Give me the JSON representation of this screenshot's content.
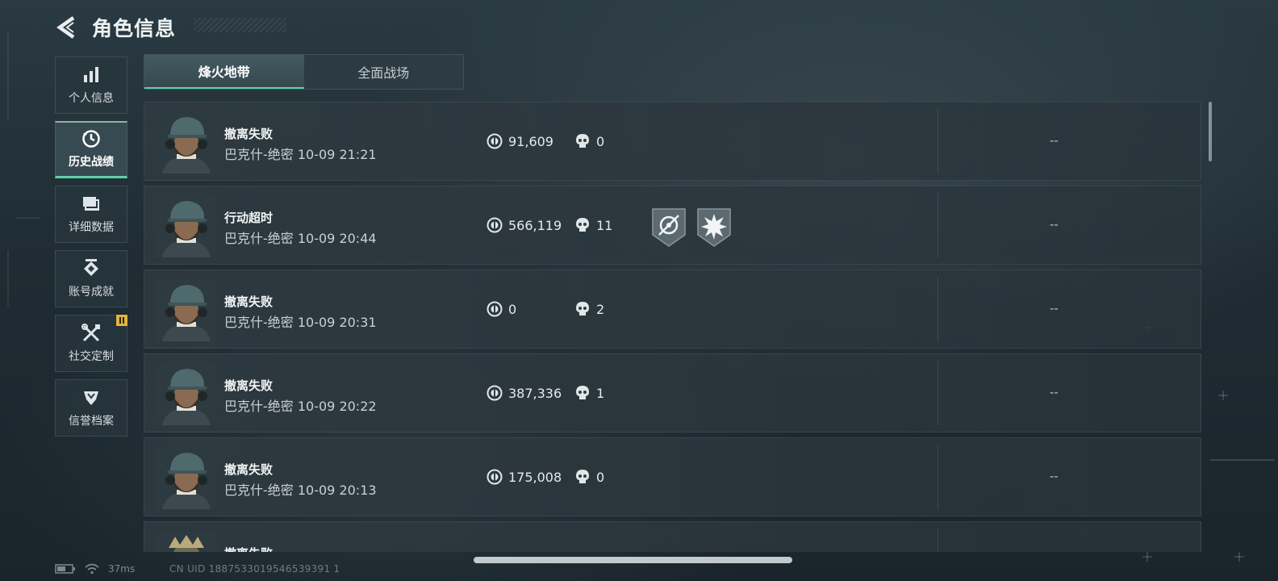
{
  "header": {
    "title": "角色信息"
  },
  "sidebar": {
    "items": [
      {
        "label": "个人信息",
        "icon": "bar-chart-icon",
        "active": false
      },
      {
        "label": "历史战绩",
        "icon": "history-clock-icon",
        "active": true
      },
      {
        "label": "详细数据",
        "icon": "stacked-cards-icon",
        "active": false
      },
      {
        "label": "账号成就",
        "icon": "achievement-badge-icon",
        "active": false
      },
      {
        "label": "社交定制",
        "icon": "wrench-screwdriver-icon",
        "active": false,
        "badge": true
      },
      {
        "label": "信誉档案",
        "icon": "shield-emblem-icon",
        "active": false
      }
    ]
  },
  "tabs": [
    {
      "label": "烽火地带",
      "active": true
    },
    {
      "label": "全面战场",
      "active": false
    }
  ],
  "matches": [
    {
      "result": "撤离失败",
      "meta": "巴克什-绝密 10-09 21:21",
      "value": "91,609",
      "kills": "0",
      "medals": [],
      "extra": "--"
    },
    {
      "result": "行动超时",
      "meta": "巴克什-绝密 10-09 20:44",
      "value": "566,119",
      "kills": "11",
      "medals": [
        "crosshair-medal-icon",
        "burst-medal-icon"
      ],
      "extra": "--"
    },
    {
      "result": "撤离失败",
      "meta": "巴克什-绝密 10-09 20:31",
      "value": "0",
      "kills": "2",
      "medals": [],
      "extra": "--"
    },
    {
      "result": "撤离失败",
      "meta": "巴克什-绝密 10-09 20:22",
      "value": "387,336",
      "kills": "1",
      "medals": [],
      "extra": "--"
    },
    {
      "result": "撤离失败",
      "meta": "巴克什-绝密 10-09 20:13",
      "value": "175,008",
      "kills": "0",
      "medals": [],
      "extra": "--"
    },
    {
      "result": "撤离失败",
      "meta": "",
      "value": "",
      "kills": "",
      "medals": [],
      "extra": ""
    }
  ],
  "status": {
    "ping": "37ms"
  },
  "uid": "CN UID 1887533019546539391 1",
  "colors": {
    "accent": "#5fd0a6",
    "badge": "#e2b43b"
  }
}
